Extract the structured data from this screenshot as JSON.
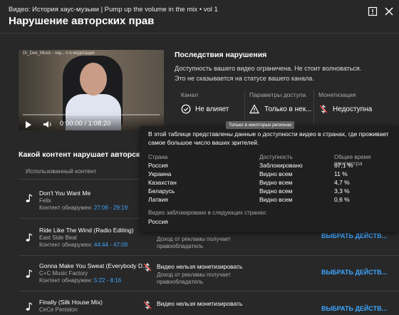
{
  "header": {
    "subtitle": "Видео: История хаус-музыки | Pump up the volume in the mix • vol 1",
    "title": "Нарушение авторских прав"
  },
  "video": {
    "overlay": "Dr_Dee_Music - хау... о  и медитации",
    "time": "0:00:00 / 1:08:20"
  },
  "consequences": {
    "title": "Последствия нарушения",
    "description": "Доступность вашего видео ограничена. Не стоит волноваться. Это не сказывается на статусе вашего канала.",
    "channel": {
      "label": "Канал",
      "value": "Не влияет"
    },
    "access": {
      "label": "Параметры доступа",
      "value": "Только в нек..."
    },
    "monetization": {
      "label": "Монетизация",
      "value": "Недоступна"
    }
  },
  "content": {
    "title": "Какой контент нарушает авторские пра",
    "col_used": "Использованный контент",
    "rows": [
      {
        "title": "Don't You Want Me",
        "artist": "Felix",
        "detected_label": "Контент обнаружен:",
        "detected_time": "27:06 - 29:19"
      },
      {
        "title": "Ride Like The Wind (Radio Editing)",
        "artist": "East Side Beat",
        "detected_label": "Контент обнаружен:",
        "detected_time": "44:44 - 47:09",
        "restr_b": "Доход от рекламы получает правообладатель",
        "action": "ВЫБРАТЬ ДЕЙСТВ..."
      },
      {
        "title": "Gonna Make You Sweat (Everybody D...",
        "artist": "C+C Music Factory",
        "detected_label": "Контент обнаружен:",
        "detected_time": "5:22 - 8:16",
        "restr_a": "Видео нельзя монетизировать",
        "restr_b": "Доход от рекламы получает правообладатель",
        "action": "ВЫБРАТЬ ДЕЙСТВ..."
      },
      {
        "title": "Finally (Silk House Mix)",
        "artist": "CeCe Peniston",
        "restr_a": "Видео нельзя монетизировать",
        "action": "ВЫБРАТЬ ДЕЙСТВ..."
      }
    ]
  },
  "tooltip": "Только в некоторых регионах",
  "popup": {
    "description": "В этой таблице представлены данные о доступности видео в странах, где проживает самое большое число ваших зрителей.",
    "headers": [
      "Страна",
      "Доступность",
      "Общее время просмотра"
    ],
    "rows": [
      [
        "Россия",
        "Заблокировано",
        "67,1 %"
      ],
      [
        "Украина",
        "Видно всем",
        "11 %"
      ],
      [
        "Казахстан",
        "Видно всем",
        "4,7 %"
      ],
      [
        "Беларусь",
        "Видно всем",
        "3,3 %"
      ],
      [
        "Латвия",
        "Видно всем",
        "0,6 %"
      ]
    ],
    "blocked_label": "Видео заблокировано в следующих странах:",
    "blocked_countries": "Россия"
  }
}
